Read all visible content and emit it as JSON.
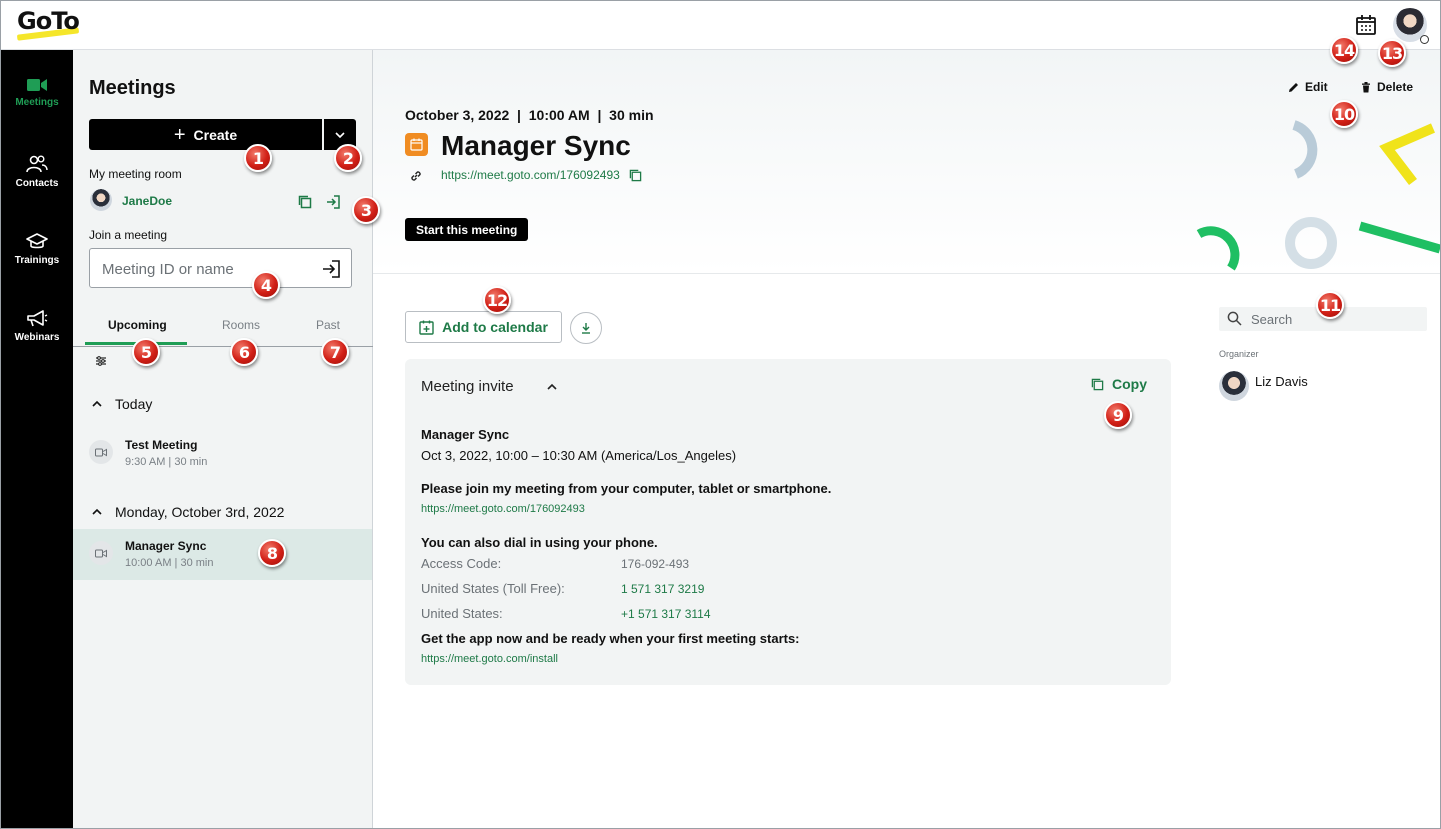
{
  "app": {
    "logo_text": "GoTo",
    "brand_green": "#1f9d55",
    "accent_yellow": "#f5e62a"
  },
  "topbar": {
    "calendar_icon": "calendar-icon",
    "avatar_icon": "user-avatar"
  },
  "nav": {
    "items": [
      {
        "label": "Meetings",
        "icon": "video-camera-icon",
        "active": true
      },
      {
        "label": "Contacts",
        "icon": "people-icon",
        "active": false
      },
      {
        "label": "Trainings",
        "icon": "graduation-cap-icon",
        "active": false
      },
      {
        "label": "Webinars",
        "icon": "megaphone-icon",
        "active": false
      }
    ]
  },
  "sidebar": {
    "title": "Meetings",
    "create_label": "Create",
    "my_room_label": "My meeting room",
    "room_name": "JaneDoe",
    "join_label": "Join a meeting",
    "join_placeholder": "Meeting ID or name",
    "tabs": [
      {
        "label": "Upcoming",
        "active": true
      },
      {
        "label": "Rooms",
        "active": false
      },
      {
        "label": "Past",
        "active": false
      }
    ],
    "groups": [
      {
        "heading": "Today",
        "meetings": [
          {
            "title": "Test Meeting",
            "time": "9:30 AM  |  30 min",
            "selected": false
          }
        ]
      },
      {
        "heading": "Monday, October 3rd, 2022",
        "meetings": [
          {
            "title": "Manager Sync",
            "time": "10:00 AM  |  30 min",
            "selected": true
          }
        ]
      }
    ]
  },
  "main": {
    "date_line": "October 3, 2022  |  10:00 AM  |  30 min",
    "title": "Manager Sync",
    "url": "https://meet.goto.com/176092493",
    "start_label": "Start this meeting",
    "edit_label": "Edit",
    "delete_label": "Delete",
    "add_calendar_label": "Add to calendar",
    "invite": {
      "heading": "Meeting invite",
      "copy_label": "Copy",
      "meeting_title": "Manager Sync",
      "when": "Oct 3, 2022, 10:00 – 10:30 AM (America/Los_Angeles)",
      "join_text": "Please join my meeting from your computer, tablet or smartphone.",
      "join_url": "https://meet.goto.com/176092493",
      "dial_text": "You can also dial in using your phone.",
      "access_label": "Access Code:",
      "access_value": "176-092-493",
      "tollfree_label": "United States (Toll Free):",
      "tollfree_value": "1 571 317 3219",
      "us_label": "United States:",
      "us_value": "+1 571 317 3114",
      "app_text": "Get the app now and be ready when your first meeting starts:",
      "app_url": "https://meet.goto.com/install"
    },
    "search_placeholder": "Search",
    "organizer_label": "Organizer",
    "organizer_name": "Liz Davis"
  },
  "callouts": [
    "1",
    "2",
    "3",
    "4",
    "5",
    "6",
    "7",
    "8",
    "9",
    "10",
    "11",
    "12",
    "13",
    "14"
  ]
}
